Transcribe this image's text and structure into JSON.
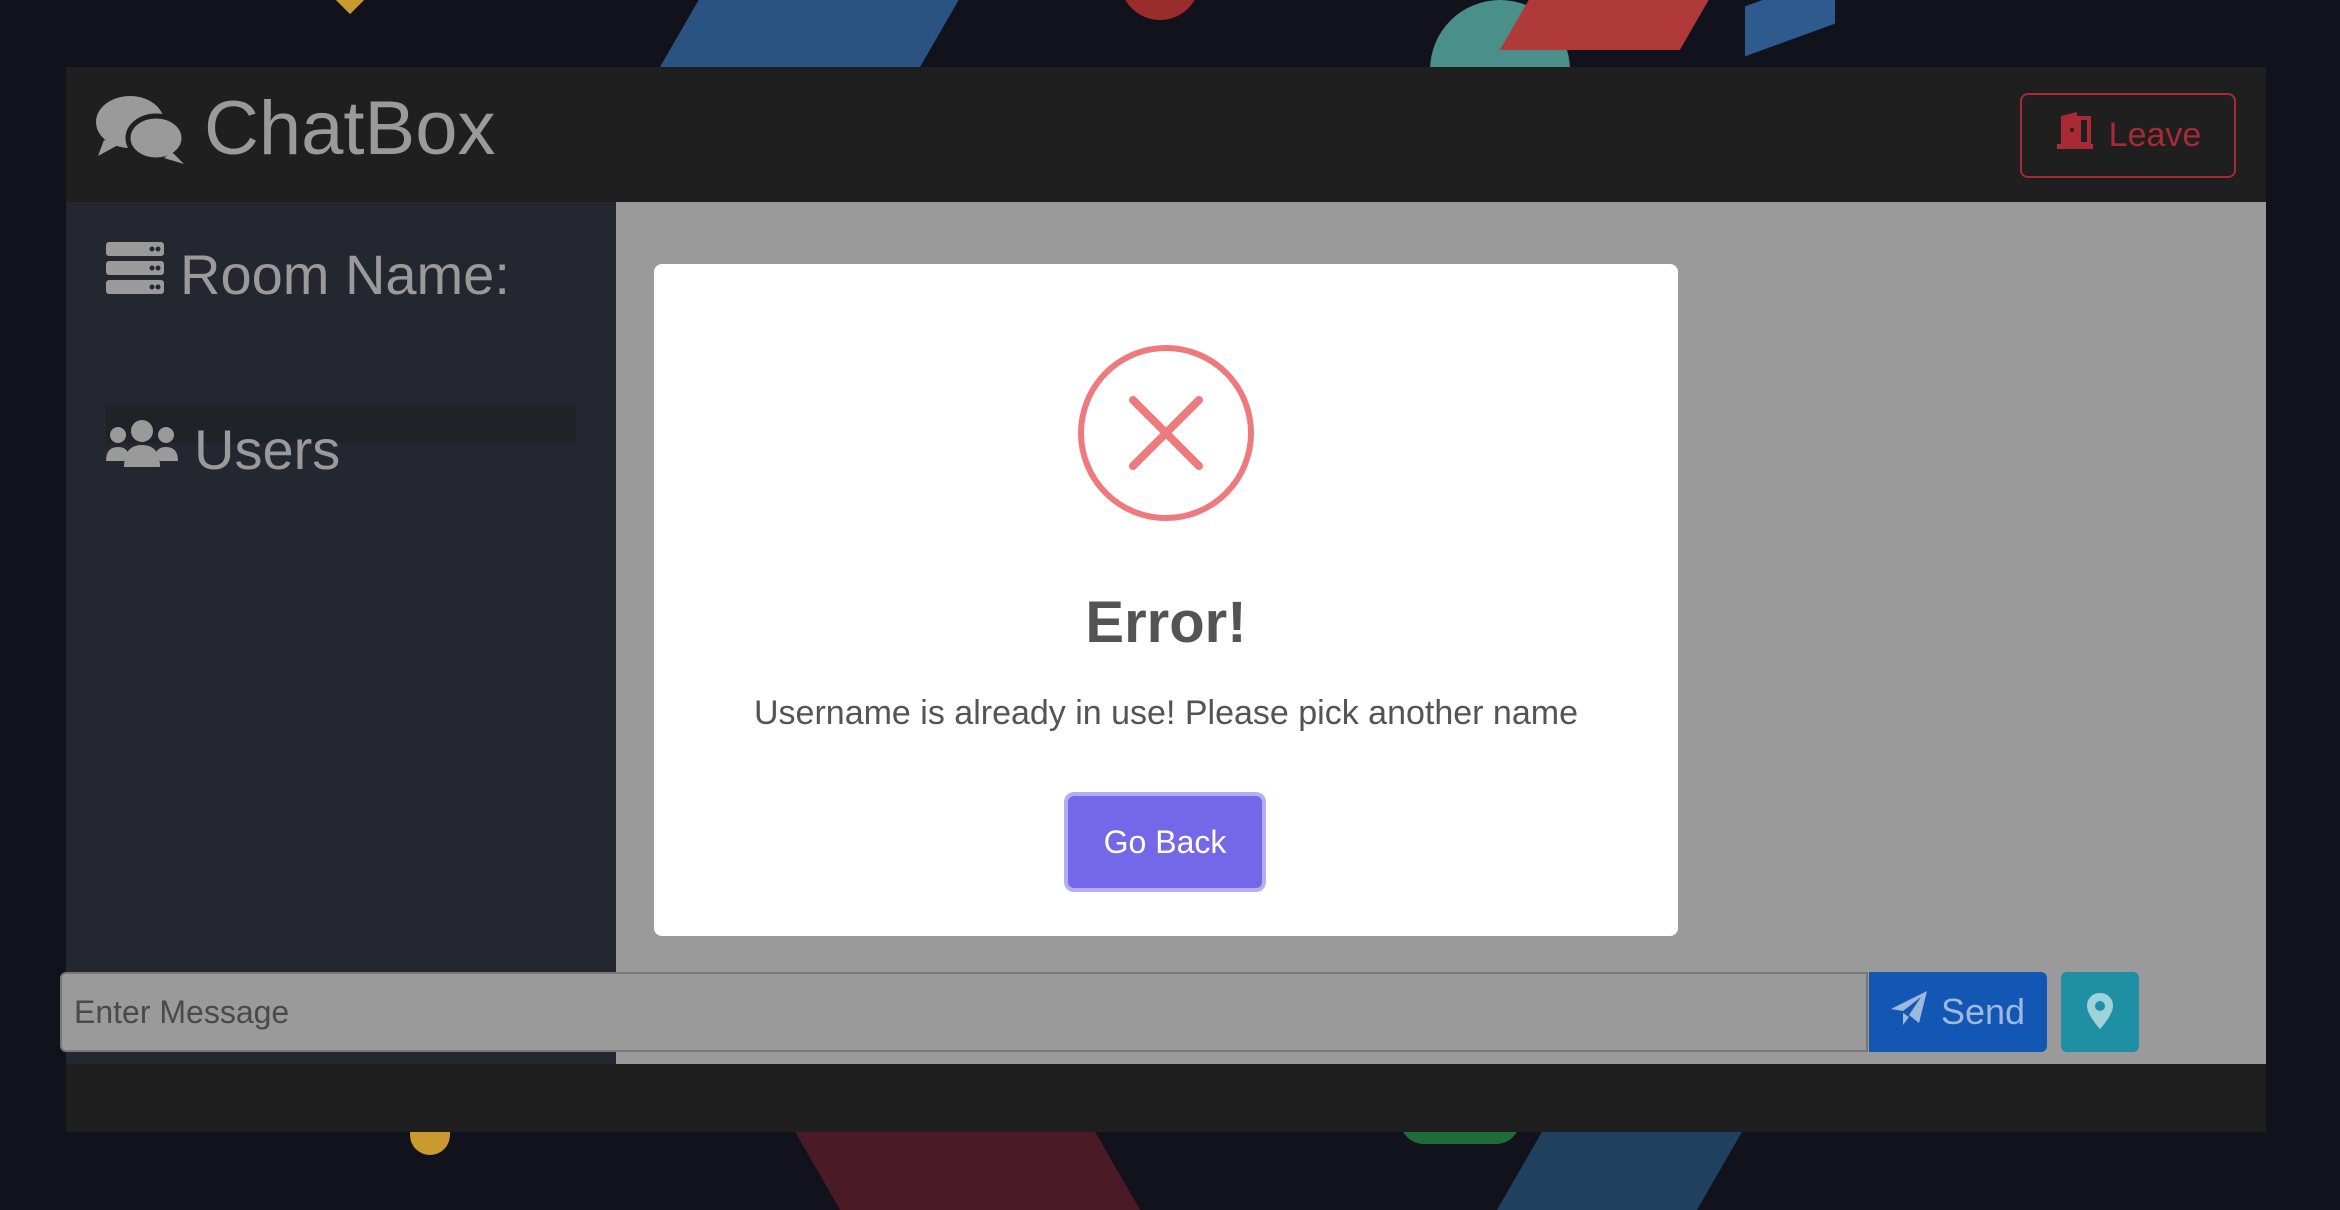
{
  "header": {
    "title": "ChatBox",
    "leave_label": "Leave"
  },
  "sidebar": {
    "room_heading": "Room Name:",
    "room_value": "",
    "users_heading": "Users"
  },
  "composer": {
    "placeholder": "Enter Message",
    "send_label": "Send"
  },
  "modal": {
    "title": "Error!",
    "message": "Username is already in use! Please pick another name",
    "button_label": "Go Back"
  },
  "colors": {
    "danger": "#a72a35",
    "send": "#1257b3",
    "location": "#1f8fa3",
    "modal_button": "#7467e8",
    "error_icon": "#ee7a7e"
  },
  "icons": [
    "comments-icon",
    "door-icon",
    "server-icon",
    "users-icon",
    "paper-plane-icon",
    "map-marker-icon",
    "error-x-icon"
  ]
}
